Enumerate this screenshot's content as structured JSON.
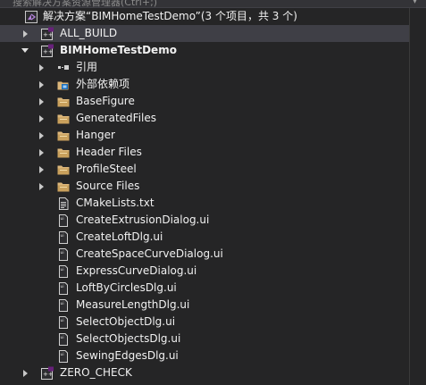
{
  "search": {
    "placeholder_fragment": "搜索解决方案资源管理器(Ctrl+;)"
  },
  "solution": {
    "label": "解决方案“BIMHomeTestDemo”(3 个项目，共 3 个)"
  },
  "projects": {
    "all_build": "ALL_BUILD",
    "main": "BIMHomeTestDemo",
    "zero_check": "ZERO_CHECK"
  },
  "items": [
    {
      "label": "引用",
      "icon": "references-icon",
      "expandable": true
    },
    {
      "label": "外部依赖项",
      "icon": "external-dependencies-icon",
      "expandable": true
    },
    {
      "label": "BaseFigure",
      "icon": "folder-icon",
      "expandable": true
    },
    {
      "label": "GeneratedFiles",
      "icon": "folder-icon",
      "expandable": true
    },
    {
      "label": "Hanger",
      "icon": "folder-icon",
      "expandable": true
    },
    {
      "label": "Header Files",
      "icon": "folder-icon",
      "expandable": true
    },
    {
      "label": "ProfileSteel",
      "icon": "folder-icon",
      "expandable": true
    },
    {
      "label": "Source Files",
      "icon": "folder-icon",
      "expandable": true
    },
    {
      "label": "CMakeLists.txt",
      "icon": "text-file-icon",
      "expandable": false
    },
    {
      "label": "CreateExtrusionDialog.ui",
      "icon": "ui-file-icon",
      "expandable": false
    },
    {
      "label": "CreateLoftDlg.ui",
      "icon": "ui-file-icon",
      "expandable": false
    },
    {
      "label": "CreateSpaceCurveDialog.ui",
      "icon": "ui-file-icon",
      "expandable": false
    },
    {
      "label": "ExpressCurveDialog.ui",
      "icon": "ui-file-icon",
      "expandable": false
    },
    {
      "label": "LoftByCirclesDlg.ui",
      "icon": "ui-file-icon",
      "expandable": false
    },
    {
      "label": "MeasureLengthDlg.ui",
      "icon": "ui-file-icon",
      "expandable": false
    },
    {
      "label": "SelectObjectDlg.ui",
      "icon": "ui-file-icon",
      "expandable": false
    },
    {
      "label": "SelectObjectsDlg.ui",
      "icon": "ui-file-icon",
      "expandable": false
    },
    {
      "label": "SewingEdgesDlg.ui",
      "icon": "ui-file-icon",
      "expandable": false
    }
  ],
  "colors": {
    "background": "#252526",
    "selected_row": "#3f3f46",
    "text": "#f1f1f1",
    "folder": "#dcb67a",
    "project_accent": "#68217a"
  }
}
